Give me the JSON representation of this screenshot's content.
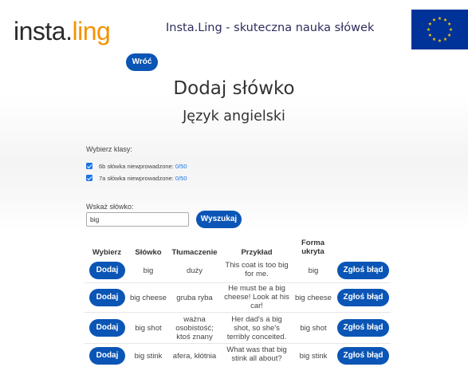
{
  "header": {
    "logo_part1": "insta.",
    "logo_part2": "ling",
    "site_title": "Insta.Ling - skuteczna nauka słówek"
  },
  "nav": {
    "back_label": "Wróć"
  },
  "page": {
    "title": "Dodaj słówko",
    "subtitle": "Język angielski"
  },
  "classes": {
    "label": "Wybierz klasy:",
    "items": [
      {
        "name": "6b",
        "text": "słówka niewprowadzone:",
        "count": "0/50",
        "checked": true
      },
      {
        "name": "7a",
        "text": "słówka niewprowadzone:",
        "count": "0/50",
        "checked": true
      }
    ]
  },
  "search": {
    "label": "Wskaż słówko:",
    "value": "big",
    "button_label": "Wyszukaj"
  },
  "table": {
    "headers": [
      "Wybierz",
      "Słówko",
      "Tłumaczenie",
      "Przykład",
      "Forma ukryta",
      ""
    ],
    "rows": [
      {
        "action": "Dodaj",
        "word": "big",
        "translation": "duży",
        "example": "This coat is too big for me.",
        "hidden": "big",
        "report": "Zgłoś błąd"
      },
      {
        "action": "Dodaj",
        "word": "big cheese",
        "translation": "gruba ryba",
        "example": "He must be a big cheese! Look at his car!",
        "hidden": "big cheese",
        "report": "Zgłoś błąd"
      },
      {
        "action": "Dodaj",
        "word": "big shot",
        "translation": "ważna osobistość; ktoś znany",
        "example": "Her dad's a big shot, so she's terribly conceited.",
        "hidden": "big shot",
        "report": "Zgłoś błąd"
      },
      {
        "action": "Dodaj",
        "word": "big stink",
        "translation": "afera, kłótnia",
        "example": "What was that big stink all about?",
        "hidden": "big stink",
        "report": "Zgłoś błąd"
      }
    ]
  },
  "colors": {
    "brand_dark": "#2b2b2b",
    "brand_orange": "#f39200",
    "button_blue": "#0a55b5",
    "eu_blue": "#003399",
    "eu_star": "#ffcc00"
  },
  "icons": {
    "flag": "eu-flag-icon",
    "checkbox": "checkbox-checked-icon"
  }
}
